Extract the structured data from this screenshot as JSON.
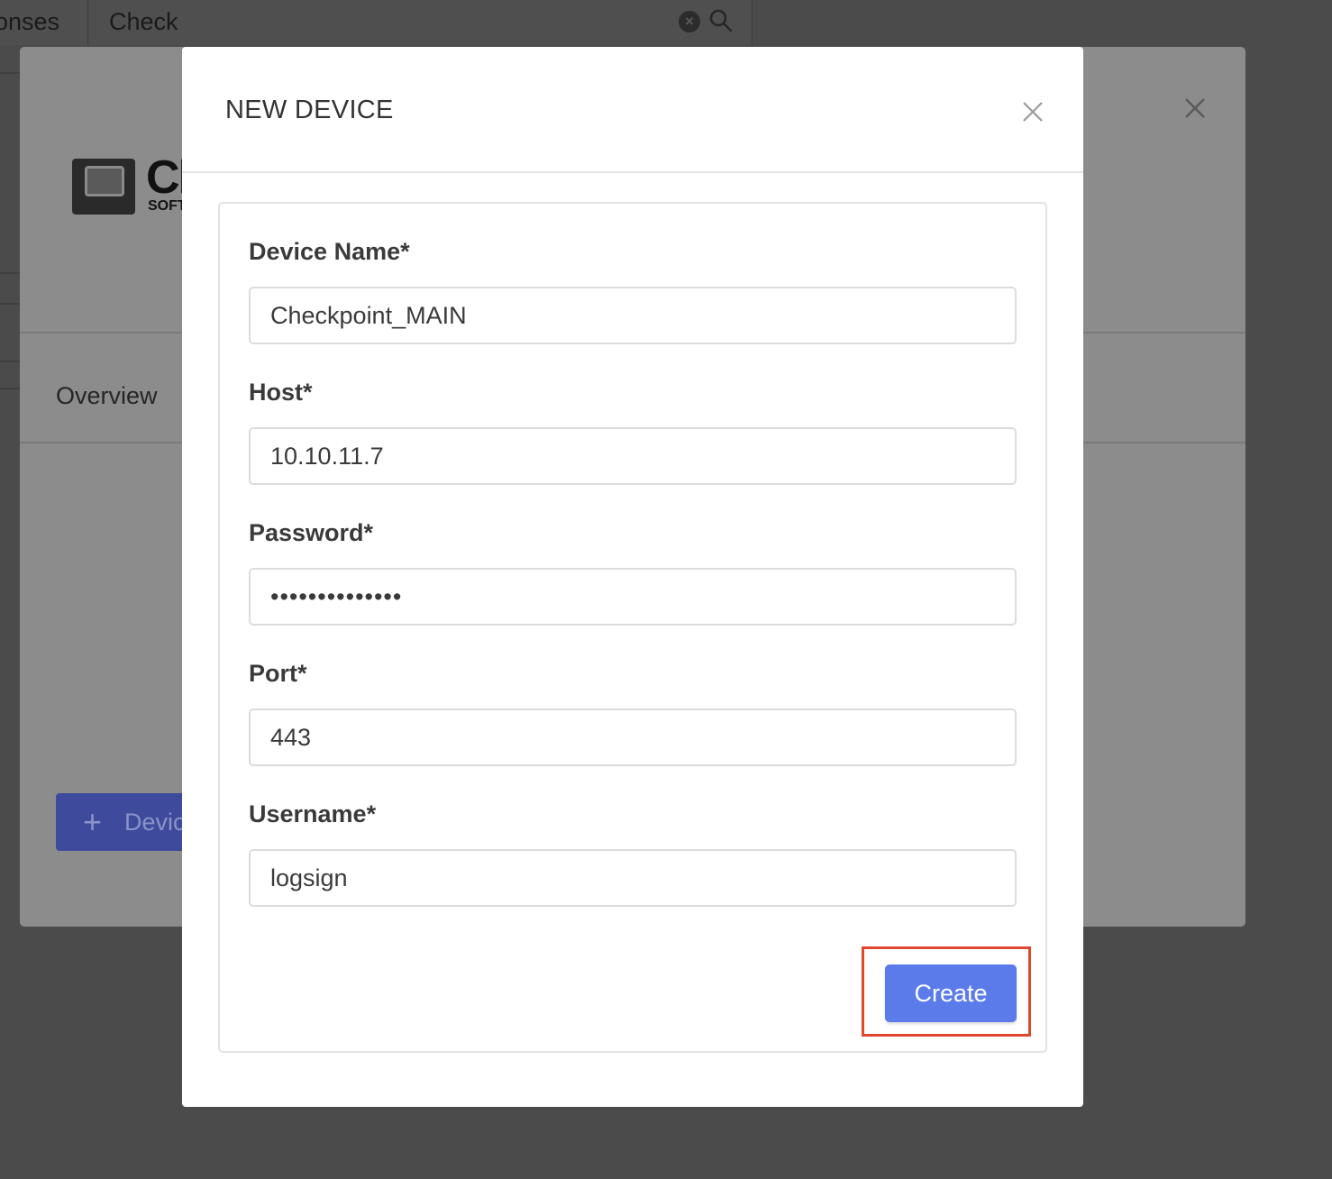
{
  "background": {
    "topbar": {
      "tab_partial": "onses",
      "search_value": "Check",
      "clear_icon": "clear-circle-icon",
      "search_icon": "search-icon"
    },
    "panel": {
      "logo_text": "Cl",
      "logo_sub": "SOFT",
      "tab_overview": "Overview",
      "add_device_label": "Devic",
      "add_device_icon": "plus-icon",
      "close_icon": "close-icon"
    },
    "edge": {
      "text": "C"
    }
  },
  "modal": {
    "title": "NEW DEVICE",
    "close_icon": "close-icon",
    "fields": [
      {
        "label": "Device Name*",
        "value": "Checkpoint_MAIN",
        "type": "text"
      },
      {
        "label": "Host*",
        "value": "10.10.11.7",
        "type": "text"
      },
      {
        "label": "Password*",
        "value": "••••••••••••••",
        "type": "password"
      },
      {
        "label": "Port*",
        "value": "443",
        "type": "text"
      },
      {
        "label": "Username*",
        "value": "logsign",
        "type": "text"
      }
    ],
    "create_label": "Create",
    "highlight_color": "#e0472f",
    "accent_color": "#5b7bea"
  }
}
